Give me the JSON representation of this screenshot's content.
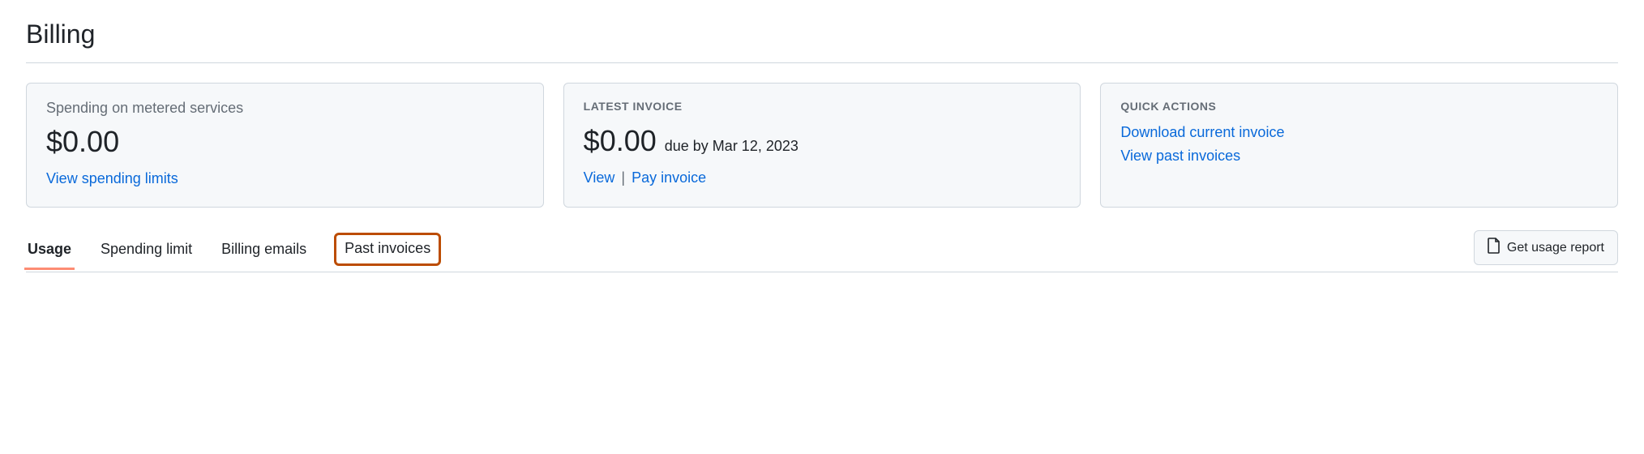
{
  "page": {
    "title": "Billing"
  },
  "cards": {
    "spending": {
      "title": "Spending on metered services",
      "amount": "$0.00",
      "link": "View spending limits"
    },
    "invoice": {
      "label": "LATEST INVOICE",
      "amount": "$0.00",
      "due_by": "due by Mar 12, 2023",
      "view_link": "View",
      "pay_link": "Pay invoice"
    },
    "quick": {
      "label": "QUICK ACTIONS",
      "download_link": "Download current invoice",
      "past_link": "View past invoices"
    }
  },
  "tabs": {
    "usage": "Usage",
    "spending_limit": "Spending limit",
    "billing_emails": "Billing emails",
    "past_invoices": "Past invoices"
  },
  "buttons": {
    "usage_report": "Get usage report"
  },
  "colors": {
    "link": "#0969da",
    "highlight": "#bc4c00",
    "active_tab": "#fd8c73"
  }
}
